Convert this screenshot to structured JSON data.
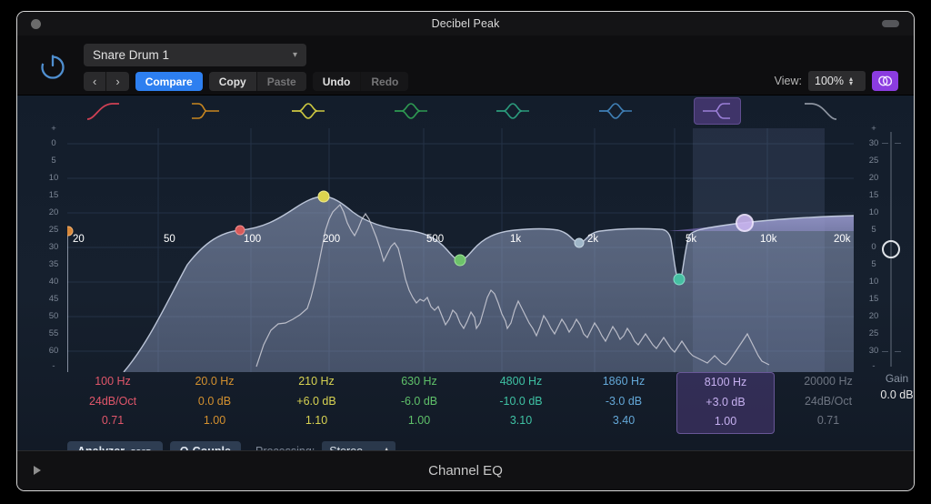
{
  "window": {
    "title": "Decibel Peak",
    "plugin_name": "Channel EQ",
    "close_icon": "close-dot-icon",
    "collapse_icon": "collapse-pill-icon",
    "footer_icon": "play-triangle-icon"
  },
  "toolbar": {
    "power_icon": "power-icon",
    "preset": "Snare Drum 1",
    "preset_chevron": "▾",
    "prev_label": "‹",
    "next_label": "›",
    "compare_label": "Compare",
    "copy_label": "Copy",
    "paste_label": "Paste",
    "undo_label": "Undo",
    "redo_label": "Redo",
    "view_label": "View:",
    "view_value": "100%",
    "stepper_up": "▴",
    "stepper_down": "▾",
    "link_icon": "link-chain-icon"
  },
  "analyzer_scale": {
    "plus": "+",
    "labels": [
      "0",
      "5",
      "10",
      "15",
      "20",
      "25",
      "30",
      "35",
      "40",
      "45",
      "50",
      "55",
      "60"
    ],
    "minus": "-"
  },
  "gain_scale": {
    "plus": "+",
    "labels": [
      "30",
      "25",
      "20",
      "15",
      "10",
      "5",
      "0",
      "5",
      "10",
      "15",
      "20",
      "25",
      "30"
    ],
    "minus": "-"
  },
  "gain": {
    "label": "Gain",
    "value": "0.0 dB"
  },
  "frequency_axis": {
    "ticks": [
      "20",
      "50",
      "100",
      "200",
      "500",
      "1k",
      "2k",
      "5k",
      "10k",
      "20k"
    ]
  },
  "bands": [
    {
      "icon": "highpass-filter-icon",
      "freq": "100 Hz",
      "gain": "24dB/Oct",
      "q": "0.71",
      "color": "#e0566a",
      "selected": false,
      "enabled": true
    },
    {
      "icon": "low-shelf-icon",
      "freq": "20.0 Hz",
      "gain": "0.0 dB",
      "q": "1.00",
      "color": "#d4912f",
      "selected": false,
      "enabled": true
    },
    {
      "icon": "bell-icon",
      "freq": "210 Hz",
      "gain": "+6.0 dB",
      "q": "1.10",
      "color": "#d8d352",
      "selected": false,
      "enabled": true
    },
    {
      "icon": "bell-icon",
      "freq": "630 Hz",
      "gain": "-6.0 dB",
      "q": "1.00",
      "color": "#5fc16a",
      "selected": false,
      "enabled": true
    },
    {
      "icon": "bell-icon",
      "freq": "4800 Hz",
      "gain": "-10.0 dB",
      "q": "3.10",
      "color": "#3fc2a4",
      "selected": false,
      "enabled": true
    },
    {
      "icon": "bell-icon",
      "freq": "1860 Hz",
      "gain": "-3.0 dB",
      "q": "3.40",
      "color": "#64a8d8",
      "selected": false,
      "enabled": true
    },
    {
      "icon": "high-shelf-icon",
      "freq": "8100 Hz",
      "gain": "+3.0 dB",
      "q": "1.00",
      "color": "#b49ae8",
      "selected": true,
      "enabled": true
    },
    {
      "icon": "lowpass-filter-icon",
      "freq": "20000 Hz",
      "gain": "24dB/Oct",
      "q": "0.71",
      "color": "#6e7582",
      "selected": false,
      "enabled": false
    }
  ],
  "bottom_controls": {
    "analyzer_label": "Analyzer",
    "analyzer_mode": "POST",
    "qcouple_label": "Q-Couple",
    "processing_label": "Processing:",
    "processing_value": "Stereo",
    "processing_arrows": "↕"
  },
  "colors": {
    "accent_blue": "#2d7ff0",
    "accent_purple": "#8b3ce0",
    "eq_curve": "#c9d4e6",
    "analyzer_line": "#d9d9e4",
    "background": "#16202e"
  }
}
